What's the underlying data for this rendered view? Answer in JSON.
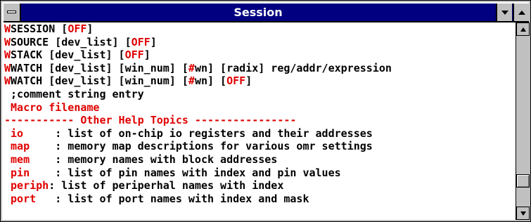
{
  "window": {
    "title": "Session"
  },
  "lines": [
    {
      "parts": [
        {
          "t": "W",
          "red": true
        },
        {
          "t": "SESSION ["
        },
        {
          "t": "OFF",
          "red": true
        },
        {
          "t": "]"
        }
      ]
    },
    {
      "parts": [
        {
          "t": "W",
          "red": true
        },
        {
          "t": "SOURCE [dev_list] ["
        },
        {
          "t": "OFF",
          "red": true
        },
        {
          "t": "]"
        }
      ]
    },
    {
      "parts": [
        {
          "t": "W",
          "red": true
        },
        {
          "t": "STACK [dev_list] ["
        },
        {
          "t": "OFF",
          "red": true
        },
        {
          "t": "]"
        }
      ]
    },
    {
      "parts": [
        {
          "t": "W",
          "red": true
        },
        {
          "t": "WATCH [dev_list] [win_num] ["
        },
        {
          "t": "#",
          "red": true
        },
        {
          "t": "wn] [radix] reg/addr/expression"
        }
      ]
    },
    {
      "parts": [
        {
          "t": "W",
          "red": true
        },
        {
          "t": "WATCH [dev_list] [win_num] ["
        },
        {
          "t": "#",
          "red": true
        },
        {
          "t": "wn] ["
        },
        {
          "t": "OFF",
          "red": true
        },
        {
          "t": "]"
        }
      ]
    },
    {
      "parts": [
        {
          "t": " ;comment string entry"
        }
      ]
    },
    {
      "parts": [
        {
          "t": " Macro filename",
          "red": true
        }
      ]
    },
    {
      "parts": [
        {
          "t": "----------- Other Help Topics ----------------",
          "red": true
        }
      ]
    },
    {
      "parts": [
        {
          "t": " io     ",
          "red": true
        },
        {
          "t": ": list of on-chip io registers and their addresses"
        }
      ]
    },
    {
      "parts": [
        {
          "t": " map    ",
          "red": true
        },
        {
          "t": ": memory map descriptions for various omr settings"
        }
      ]
    },
    {
      "parts": [
        {
          "t": " mem    ",
          "red": true
        },
        {
          "t": ": memory names with block addresses"
        }
      ]
    },
    {
      "parts": [
        {
          "t": " pin    ",
          "red": true
        },
        {
          "t": ": list of pin names with index and pin values"
        }
      ]
    },
    {
      "parts": [
        {
          "t": " periph",
          "red": true
        },
        {
          "t": ": list of periperhal names with index"
        }
      ]
    },
    {
      "parts": [
        {
          "t": " port   ",
          "red": true
        },
        {
          "t": ": list of port names with index and mask"
        }
      ]
    }
  ],
  "icons": {
    "system_menu": "system-menu-icon",
    "minimize": "minimize-icon",
    "maximize": "maximize-icon",
    "scroll_up": "scroll-up-arrow-icon",
    "scroll_down": "scroll-down-arrow-icon"
  },
  "colors": {
    "title_bar": "#000080",
    "highlight_text": "#e00000",
    "body_text": "#000000",
    "chrome": "#c0c0c0"
  }
}
